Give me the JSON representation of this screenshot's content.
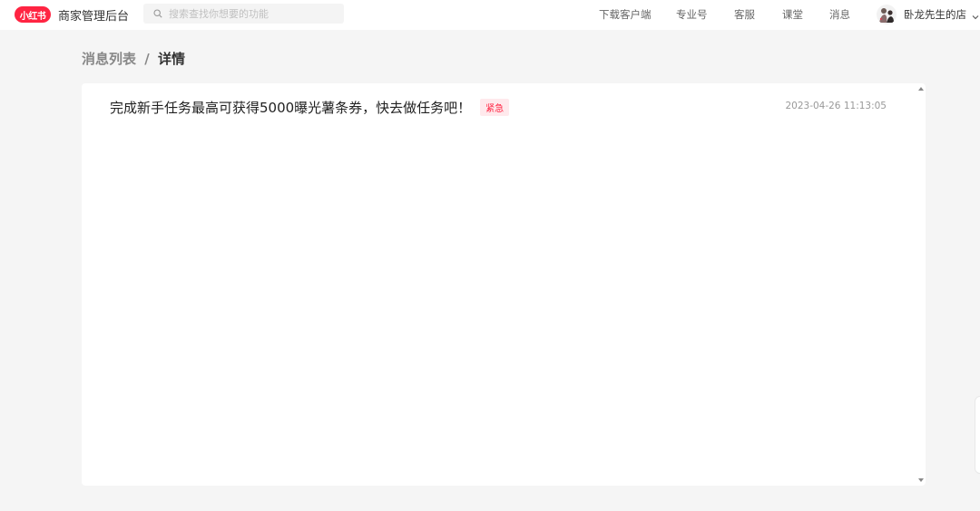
{
  "header": {
    "logo_text": "小红书",
    "app_title": "商家管理后台",
    "search": {
      "placeholder": "搜索查找你想要的功能",
      "value": ""
    },
    "nav": [
      {
        "label": "下载客户端"
      },
      {
        "label": "专业号"
      },
      {
        "label": "客服"
      },
      {
        "label": "课堂"
      },
      {
        "label": "消息"
      }
    ],
    "user": {
      "name": "卧龙先生的店"
    }
  },
  "breadcrumb": {
    "parent": "消息列表",
    "separator": "/",
    "current": "详情"
  },
  "message": {
    "title": "完成新手任务最高可获得5000曝光薯条券，快去做任务吧！",
    "badge": "紧急",
    "timestamp": "2023-04-26 11:13:05"
  },
  "colors": {
    "brand": "#ff2442",
    "background": "#f5f5f5",
    "badge_bg": "#ffe9ec"
  }
}
